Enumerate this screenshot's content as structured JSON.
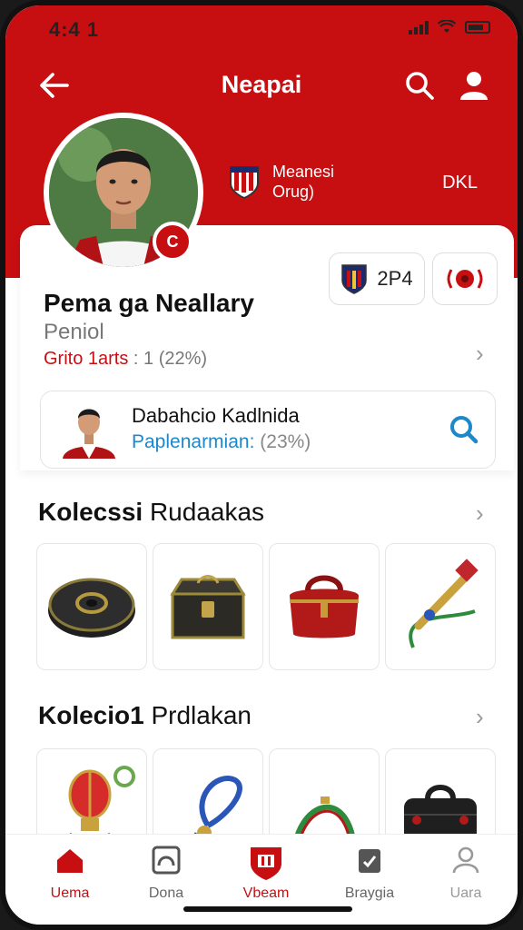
{
  "status_bar": {
    "time": "4:4 1"
  },
  "header": {
    "title": "Neapai"
  },
  "club": {
    "line1": "Meanesi",
    "line2": "Orug)",
    "value": "DKL"
  },
  "profile": {
    "badge": "C",
    "name": "Pema ga Neallary",
    "role": "Peniol",
    "stat_label": "Grito 1arts",
    "stat_value": ": 1 (22%)",
    "stat_box1_value": "2P4"
  },
  "player": {
    "name": "Dabahcio Kadlnida",
    "stat_label": "Paplenarmian:",
    "stat_value": "(23%)"
  },
  "sections": [
    {
      "bold": "Kolecssi",
      "rest": "Rudaakas"
    },
    {
      "bold": "Kolecio1",
      "rest": "Prdlakan"
    }
  ],
  "section_1_items": [
    {
      "icon": "drum-icon"
    },
    {
      "icon": "treasure-chest-icon"
    },
    {
      "icon": "red-bag-icon"
    },
    {
      "icon": "flute-icon"
    }
  ],
  "section_2_items": [
    {
      "icon": "lantern-icon"
    },
    {
      "icon": "blue-rope-icon"
    },
    {
      "icon": "strap-icon"
    },
    {
      "icon": "black-case-icon"
    }
  ],
  "bottom_nav": [
    {
      "label": "Uema",
      "icon": "home-icon",
      "active": true
    },
    {
      "label": "Dona",
      "icon": "gallery-icon",
      "active": false
    },
    {
      "label": "Vbeam",
      "icon": "shield-icon",
      "active": true
    },
    {
      "label": "Braygia",
      "icon": "doc-check-icon",
      "active": false
    },
    {
      "label": "Uara",
      "icon": "profile-icon",
      "active": false
    }
  ],
  "colors": {
    "primary": "#c70f12",
    "accent_blue": "#1c87c9"
  }
}
